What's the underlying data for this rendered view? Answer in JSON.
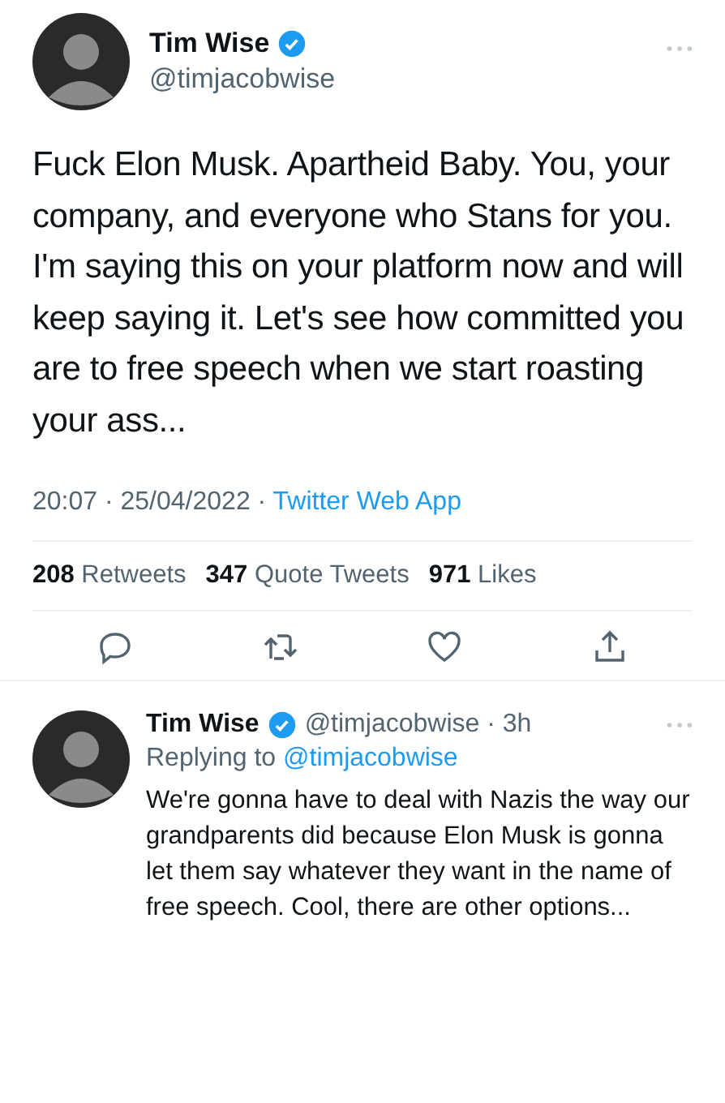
{
  "tweet": {
    "author": {
      "name": "Tim Wise",
      "handle": "@timjacobwise",
      "verified": true
    },
    "text": "Fuck Elon Musk. Apartheid Baby. You, your company, and everyone who Stans for you. I'm saying this on your platform now and will keep saying it. Let's see how committed you are to free speech when we start roasting your ass...",
    "timestamp": "20:07 · 25/04/2022 ·",
    "source": "Twitter Web App",
    "stats": [
      {
        "count": "208",
        "label": "Retweets"
      },
      {
        "count": "347",
        "label": "Quote Tweets"
      },
      {
        "count": "971",
        "label": "Likes"
      }
    ]
  },
  "reply": {
    "author": {
      "name": "Tim Wise",
      "handle": "@timjacobwise · 3h",
      "verified": true
    },
    "replying_label": "Replying to",
    "replying_handle": "@timjacobwise",
    "text": "We're gonna have to deal with Nazis the way our grandparents did because Elon Musk is gonna let them say whatever they want in the name of free speech. Cool, there are other options..."
  }
}
